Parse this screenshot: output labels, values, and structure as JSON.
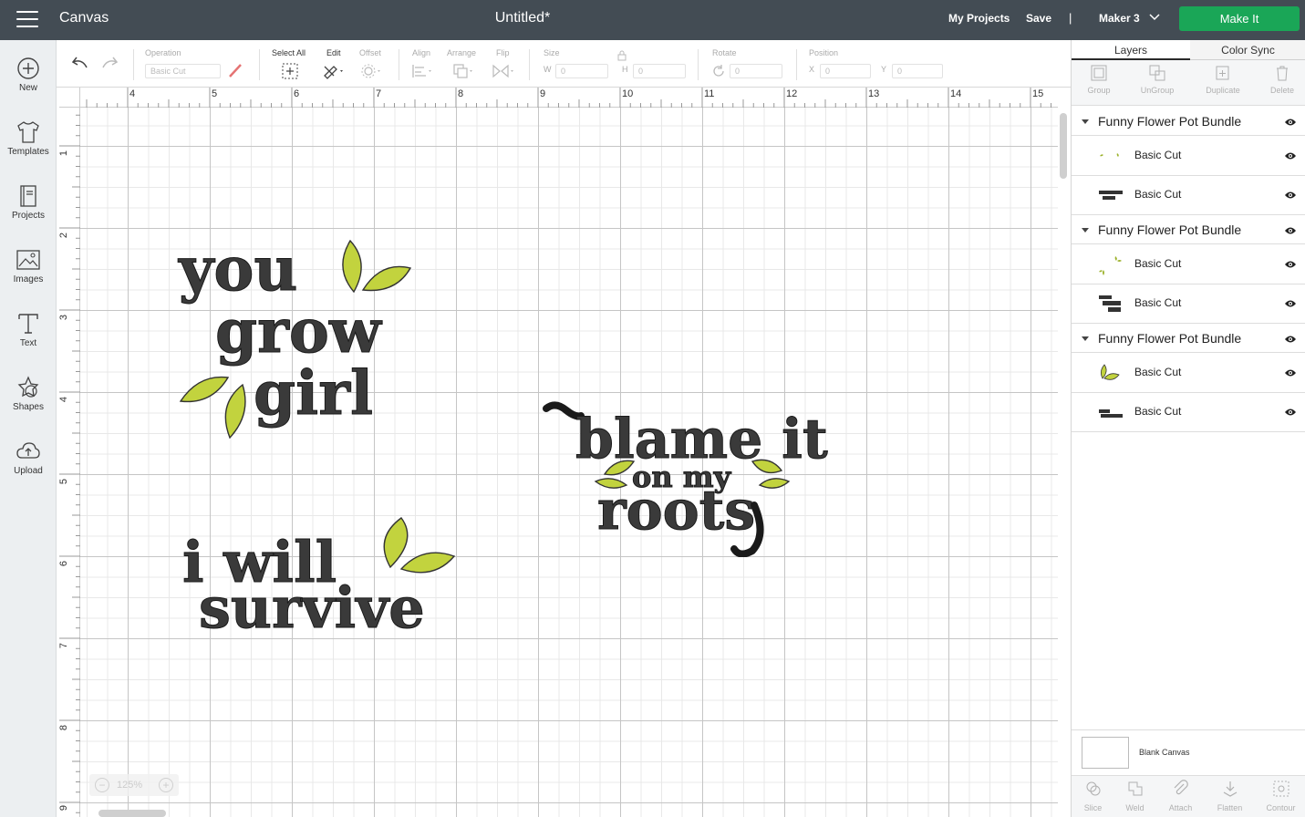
{
  "header": {
    "app_title": "Canvas",
    "doc_title": "Untitled*",
    "my_projects": "My Projects",
    "save": "Save",
    "separator": "|",
    "machine": "Maker 3",
    "make_it": "Make It",
    "accent_color": "#1aa657",
    "bar_color": "#434c54"
  },
  "sidebar": {
    "items": [
      {
        "label": "New",
        "icon": "plus-circle-icon"
      },
      {
        "label": "Templates",
        "icon": "tshirt-icon"
      },
      {
        "label": "Projects",
        "icon": "book-icon"
      },
      {
        "label": "Images",
        "icon": "image-icon"
      },
      {
        "label": "Text",
        "icon": "text-t-icon"
      },
      {
        "label": "Shapes",
        "icon": "shapes-icon"
      },
      {
        "label": "Upload",
        "icon": "cloud-upload-icon"
      }
    ]
  },
  "toolbar": {
    "operation_label": "Operation",
    "operation_value": "Basic Cut",
    "select_all": "Select All",
    "edit": "Edit",
    "offset": "Offset",
    "align": "Align",
    "arrange": "Arrange",
    "flip": "Flip",
    "size": "Size",
    "w_label": "W",
    "w_value": "0",
    "h_label": "H",
    "h_value": "0",
    "rotate": "Rotate",
    "rotate_value": "0",
    "position": "Position",
    "x_label": "X",
    "x_value": "0",
    "y_label": "Y",
    "y_value": "0"
  },
  "rulers": {
    "top": [
      "4",
      "5",
      "6",
      "7",
      "8",
      "9",
      "10",
      "11",
      "12",
      "13",
      "14",
      "15"
    ],
    "left": [
      "1",
      "2",
      "3",
      "4",
      "5",
      "6",
      "7",
      "8",
      "9"
    ]
  },
  "zoom": {
    "minus": "−",
    "value": "125%",
    "plus": "+"
  },
  "designs": {
    "you_grow_girl": [
      "you",
      "grow",
      "girl"
    ],
    "blame_it": [
      "blame it",
      "on my",
      "roots"
    ],
    "i_will_survive": [
      "i will",
      "survive"
    ],
    "leaf_color": "#c2d33e",
    "text_color": "#3a3a3a"
  },
  "panel": {
    "tabs": [
      "Layers",
      "Color Sync"
    ],
    "actions": [
      "Group",
      "UnGroup",
      "Duplicate",
      "Delete"
    ],
    "groups": [
      {
        "name": "Funny Flower Pot Bundle",
        "layers": [
          "Basic Cut",
          "Basic Cut"
        ]
      },
      {
        "name": "Funny Flower Pot Bundle",
        "layers": [
          "Basic Cut",
          "Basic Cut"
        ]
      },
      {
        "name": "Funny Flower Pot Bundle",
        "layers": [
          "Basic Cut",
          "Basic Cut"
        ]
      }
    ],
    "blank_canvas": "Blank Canvas",
    "bottom_actions": [
      "Slice",
      "Weld",
      "Attach",
      "Flatten",
      "Contour"
    ]
  }
}
